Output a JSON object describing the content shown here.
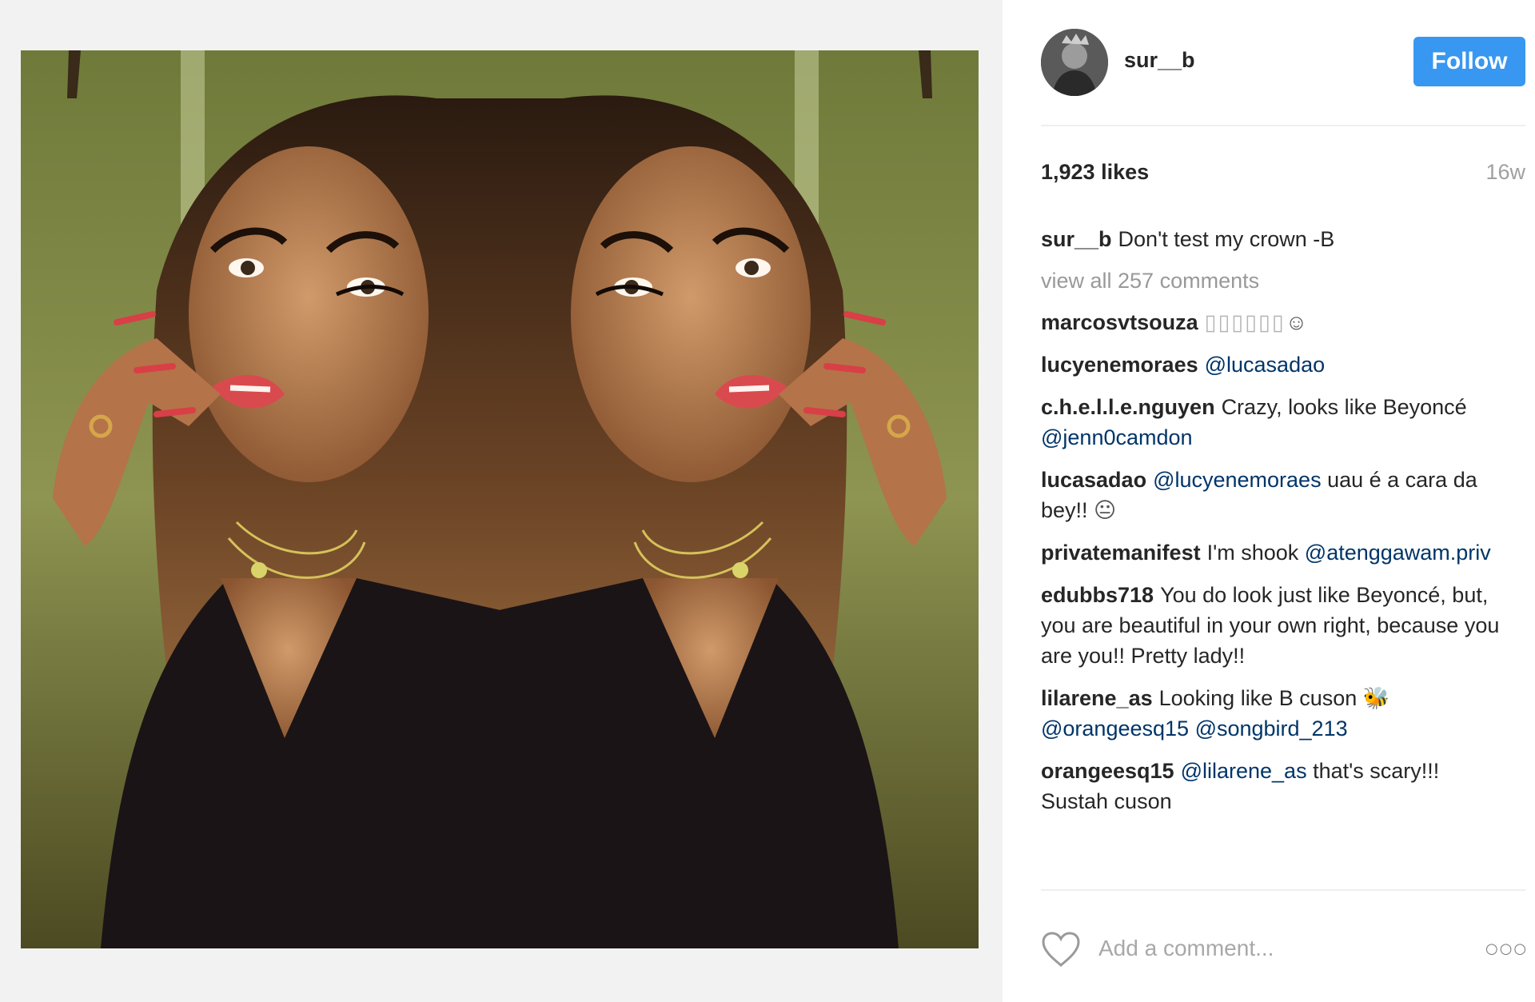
{
  "post": {
    "username": "sur__b",
    "follow_label": "Follow",
    "likes": "1,923 likes",
    "age": "16w",
    "caption": {
      "user": "sur__b",
      "text": "Don't test my crown -B"
    },
    "view_all": "view all 257 comments",
    "comments": [
      {
        "user": "marcosvtsouza",
        "parts": [
          {
            "t": "▯▯▯▯▯▯",
            "k": "missing"
          },
          {
            "t": "☺",
            "k": "emoji"
          }
        ]
      },
      {
        "user": "lucyenemoraes",
        "parts": [
          {
            "t": "@lucasadao",
            "k": "mention"
          }
        ]
      },
      {
        "user": "c.h.e.l.l.e.nguyen",
        "parts": [
          {
            "t": "Crazy, looks like Beyoncé ",
            "k": "text"
          },
          {
            "t": "@jenn0camdon",
            "k": "mention"
          }
        ]
      },
      {
        "user": "lucasadao",
        "parts": [
          {
            "t": "@lucyenemoraes",
            "k": "mention"
          },
          {
            "t": " uau é a cara da bey!! ",
            "k": "text"
          },
          {
            "t": "😐",
            "k": "emoji"
          }
        ]
      },
      {
        "user": "privatemanifest",
        "parts": [
          {
            "t": "I'm shook ",
            "k": "text"
          },
          {
            "t": "@atenggawam.priv",
            "k": "mention"
          }
        ]
      },
      {
        "user": "edubbs718",
        "parts": [
          {
            "t": "You do look just like Beyoncé, but, you are beautiful in your own right, because you are you!! Pretty lady!!",
            "k": "text"
          }
        ]
      },
      {
        "user": "lilarene_as",
        "parts": [
          {
            "t": "Looking like B cuson ",
            "k": "text"
          },
          {
            "t": "🐝",
            "k": "emoji"
          },
          {
            "t": " ",
            "k": "text"
          },
          {
            "t": "@orangeesq15",
            "k": "mention"
          },
          {
            "t": " ",
            "k": "text"
          },
          {
            "t": "@songbird_213",
            "k": "mention"
          }
        ]
      },
      {
        "user": "orangeesq15",
        "parts": [
          {
            "t": "@lilarene_as",
            "k": "mention"
          },
          {
            "t": " that's scary!!! Sustah cuson",
            "k": "text"
          }
        ]
      }
    ],
    "comment_placeholder": "Add a comment...",
    "more_label": "○○○"
  },
  "icons": {
    "like": "heart-outline-icon",
    "more": "more-options-icon"
  },
  "colors": {
    "accent": "#3897f0",
    "mention": "#003569",
    "muted": "#999999",
    "divider": "#efefef",
    "media_background": "#f2f2f2"
  }
}
